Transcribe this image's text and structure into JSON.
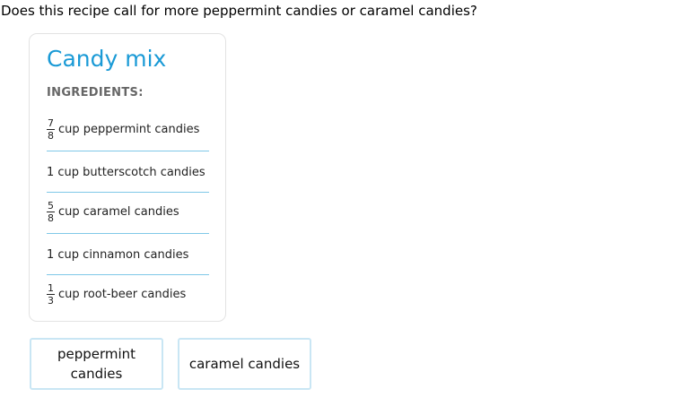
{
  "question": "Does this recipe call for more peppermint candies or caramel candies?",
  "card": {
    "title": "Candy mix",
    "subtitle": "INGREDIENTS:",
    "ingredients": [
      {
        "numerator": "7",
        "denominator": "8",
        "text": "cup peppermint candies"
      },
      {
        "text": "1 cup butterscotch candies"
      },
      {
        "numerator": "5",
        "denominator": "8",
        "text": "cup caramel candies"
      },
      {
        "text": "1 cup cinnamon candies"
      },
      {
        "numerator": "1",
        "denominator": "3",
        "text": "cup root-beer candies"
      }
    ]
  },
  "answers": [
    "peppermint candies",
    "caramel candies"
  ],
  "colors": {
    "title": "#1a9ad6",
    "divider": "#7fc8e8",
    "answer_border": "#c9e6f4"
  }
}
